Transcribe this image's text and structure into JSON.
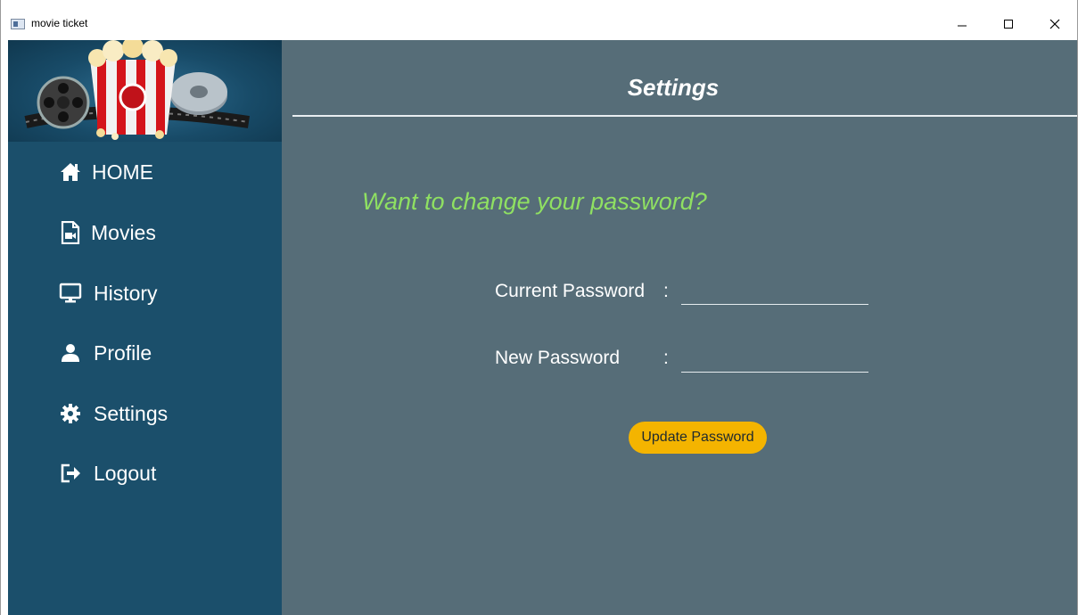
{
  "window": {
    "title": "movie ticket",
    "controls": {
      "minimize_icon": "minimize-icon",
      "maximize_icon": "maximize-icon",
      "close_icon": "close-icon"
    }
  },
  "sidebar": {
    "banner_image": "movie-popcorn-banner",
    "items": [
      {
        "label": "HOME",
        "icon": "home-icon"
      },
      {
        "label": "Movies",
        "icon": "movie-file-icon"
      },
      {
        "label": "History",
        "icon": "monitor-icon"
      },
      {
        "label": "Profile",
        "icon": "user-icon"
      },
      {
        "label": "Settings",
        "icon": "gear-icon"
      },
      {
        "label": "Logout",
        "icon": "logout-icon"
      }
    ]
  },
  "main": {
    "title": "Settings",
    "question": "Want to change your password?",
    "current_password": {
      "label": "Current Password",
      "colon": ":",
      "value": ""
    },
    "new_password": {
      "label": "New Password",
      "colon": ":",
      "value": ""
    },
    "update_button_label": "Update Password"
  },
  "colors": {
    "sidebar_bg": "#1b4f6b",
    "main_bg": "#566d78",
    "question_text": "#8fe062",
    "button_bg": "#f4b400"
  }
}
